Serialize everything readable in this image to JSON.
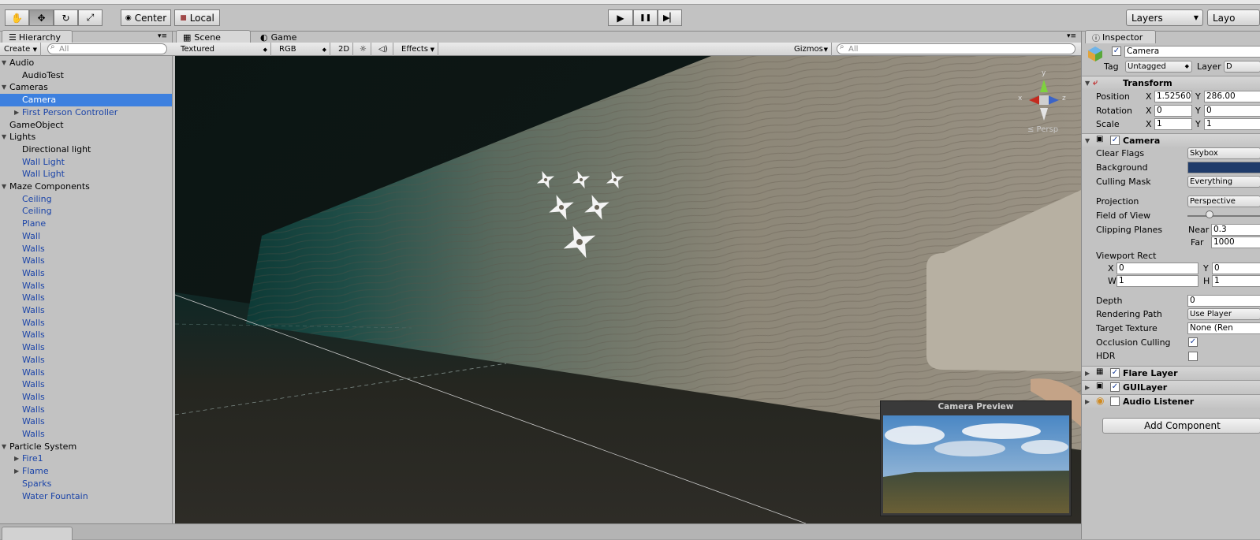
{
  "toolbar": {
    "tools": [
      {
        "icon": "hand-icon",
        "glyph": "✋"
      },
      {
        "icon": "move-icon",
        "glyph": "✥"
      },
      {
        "icon": "rotate-icon",
        "glyph": "↻"
      },
      {
        "icon": "scale-icon",
        "glyph": "⤢"
      }
    ],
    "pivot": "Center",
    "space": "Local",
    "play": "▶",
    "pause": "❚❚",
    "step": "▶▏",
    "layers": "Layers",
    "layout": "Layo"
  },
  "hierarchy": {
    "tab": "Hierarchy",
    "create": "Create",
    "search_placeholder": "All",
    "items": [
      {
        "label": "Audio",
        "indent": 0,
        "fold": "open",
        "blue": false
      },
      {
        "label": "AudioTest",
        "indent": 2,
        "fold": "none",
        "blue": false
      },
      {
        "label": "Cameras",
        "indent": 0,
        "fold": "open",
        "blue": false
      },
      {
        "label": "Camera",
        "indent": 2,
        "fold": "none",
        "blue": false,
        "selected": true
      },
      {
        "label": "First Person Controller",
        "indent": 2,
        "fold": "closed",
        "blue": true
      },
      {
        "label": "GameObject",
        "indent": 1,
        "fold": "none",
        "blue": false
      },
      {
        "label": "Lights",
        "indent": 0,
        "fold": "open",
        "blue": false
      },
      {
        "label": "Directional light",
        "indent": 2,
        "fold": "none",
        "blue": false
      },
      {
        "label": "Wall Light",
        "indent": 2,
        "fold": "none",
        "blue": true
      },
      {
        "label": "Wall Light",
        "indent": 2,
        "fold": "none",
        "blue": true
      },
      {
        "label": "Maze Components",
        "indent": 0,
        "fold": "open",
        "blue": false
      },
      {
        "label": "Ceiling",
        "indent": 2,
        "fold": "none",
        "blue": true
      },
      {
        "label": "Ceiling",
        "indent": 2,
        "fold": "none",
        "blue": true
      },
      {
        "label": "Plane",
        "indent": 2,
        "fold": "none",
        "blue": true
      },
      {
        "label": "Wall",
        "indent": 2,
        "fold": "none",
        "blue": true
      },
      {
        "label": "Walls",
        "indent": 2,
        "fold": "none",
        "blue": true
      },
      {
        "label": "Walls",
        "indent": 2,
        "fold": "none",
        "blue": true
      },
      {
        "label": "Walls",
        "indent": 2,
        "fold": "none",
        "blue": true
      },
      {
        "label": "Walls",
        "indent": 2,
        "fold": "none",
        "blue": true
      },
      {
        "label": "Walls",
        "indent": 2,
        "fold": "none",
        "blue": true
      },
      {
        "label": "Walls",
        "indent": 2,
        "fold": "none",
        "blue": true
      },
      {
        "label": "Walls",
        "indent": 2,
        "fold": "none",
        "blue": true
      },
      {
        "label": "Walls",
        "indent": 2,
        "fold": "none",
        "blue": true
      },
      {
        "label": "Walls",
        "indent": 2,
        "fold": "none",
        "blue": true
      },
      {
        "label": "Walls",
        "indent": 2,
        "fold": "none",
        "blue": true
      },
      {
        "label": "Walls",
        "indent": 2,
        "fold": "none",
        "blue": true
      },
      {
        "label": "Walls",
        "indent": 2,
        "fold": "none",
        "blue": true
      },
      {
        "label": "Walls",
        "indent": 2,
        "fold": "none",
        "blue": true
      },
      {
        "label": "Walls",
        "indent": 2,
        "fold": "none",
        "blue": true
      },
      {
        "label": "Walls",
        "indent": 2,
        "fold": "none",
        "blue": true
      },
      {
        "label": "Walls",
        "indent": 2,
        "fold": "none",
        "blue": true
      },
      {
        "label": "Particle System",
        "indent": 0,
        "fold": "open",
        "blue": false
      },
      {
        "label": "Fire1",
        "indent": 2,
        "fold": "closed",
        "blue": true
      },
      {
        "label": "Flame",
        "indent": 2,
        "fold": "closed",
        "blue": true
      },
      {
        "label": "Sparks",
        "indent": 2,
        "fold": "none",
        "blue": true
      },
      {
        "label": "Water Fountain",
        "indent": 2,
        "fold": "none",
        "blue": true
      }
    ]
  },
  "scene": {
    "tab_scene": "Scene",
    "tab_game": "Game",
    "shading": "Textured",
    "render": "RGB",
    "mode2d": "2D",
    "sun": "☼",
    "audio": "◁)",
    "effects": "Effects",
    "gizmos": "Gizmos",
    "search_placeholder": "All",
    "persp": "≤ Persp",
    "axis_y": "y",
    "axis_x": "x",
    "axis_z": "z",
    "preview_title": "Camera Preview"
  },
  "inspector": {
    "tab": "Inspector",
    "object_name": "Camera",
    "tag_label": "Tag",
    "tag_value": "Untagged",
    "layer_label": "Layer",
    "layer_value": "D",
    "transform": {
      "title": "Transform",
      "rows": [
        {
          "label": "Position",
          "x": "1.52560",
          "y": "286.00"
        },
        {
          "label": "Rotation",
          "x": "0",
          "y": "0"
        },
        {
          "label": "Scale",
          "x": "1",
          "y": "1"
        }
      ]
    },
    "camera": {
      "title": "Camera",
      "clear_flags_label": "Clear Flags",
      "clear_flags": "Skybox",
      "background_label": "Background",
      "background_color": "#1f3b6a",
      "culling_mask_label": "Culling Mask",
      "culling_mask": "Everything",
      "projection_label": "Projection",
      "projection": "Perspective",
      "fov_label": "Field of View",
      "fov_fraction": 0.3,
      "clipping_label": "Clipping Planes",
      "near_label": "Near",
      "near": "0.3",
      "far_label": "Far",
      "far": "1000",
      "viewport_label": "Viewport Rect",
      "vx": "0",
      "vy": "0",
      "vw": "1",
      "vh": "1",
      "depth_label": "Depth",
      "depth": "0",
      "rendering_path_label": "Rendering Path",
      "rendering_path": "Use Player",
      "target_texture_label": "Target Texture",
      "target_texture": "None (Ren",
      "occlusion_label": "Occlusion Culling",
      "occlusion": true,
      "hdr_label": "HDR",
      "hdr": false
    },
    "flare_layer": "Flare Layer",
    "gui_layer": "GUILayer",
    "audio_listener": "Audio Listener",
    "add_component": "Add Component",
    "x": "X",
    "y": "Y",
    "w": "W",
    "h": "H"
  }
}
